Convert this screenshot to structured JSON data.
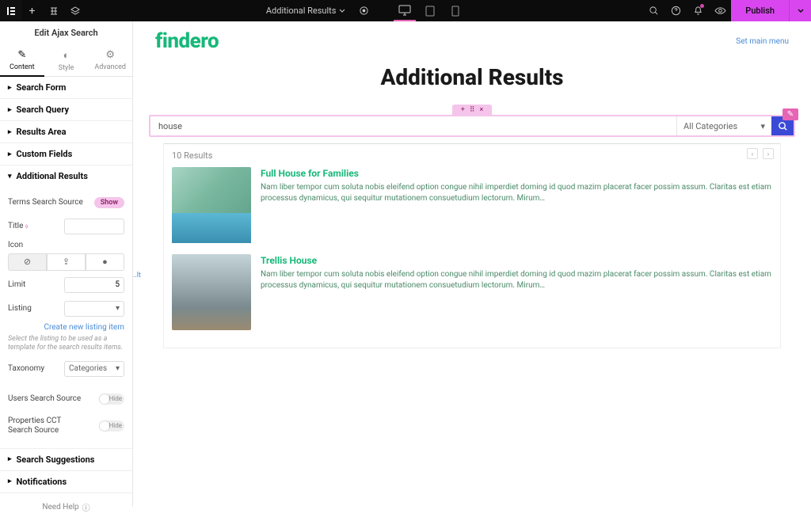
{
  "topbar": {
    "doc_label": "Additional Results",
    "publish": "Publish"
  },
  "sidebar": {
    "title": "Edit Ajax Search",
    "tabs": {
      "content": "Content",
      "style": "Style",
      "advanced": "Advanced"
    },
    "sections": {
      "search_form": "Search Form",
      "search_query": "Search Query",
      "results_area": "Results Area",
      "custom_fields": "Custom Fields",
      "additional_results": "Additional Results",
      "search_suggestions": "Search Suggestions",
      "notifications": "Notifications"
    },
    "ar": {
      "terms_source_label": "Terms Search Source",
      "terms_source_badge": "Show",
      "title_label": "Title",
      "icon_label": "Icon",
      "limit_label": "Limit",
      "limit_value": "5",
      "listing_label": "Listing",
      "create_link": "Create new listing item",
      "hint": "Select the listing to be used as a template for the search results items.",
      "taxonomy_label": "Taxonomy",
      "taxonomy_value": "Categories",
      "users_source_label": "Users Search Source",
      "users_source_toggle": "Hide",
      "props_source_label": "Properties CCT Search Source",
      "props_source_toggle": "Hide"
    },
    "help": "Need Help"
  },
  "preview": {
    "logo": "findero",
    "menu_link": "Set main menu",
    "page_title": "Additional Results",
    "search_value": "house",
    "cat_label": "All Categories",
    "results_count": "10 Results",
    "items": [
      {
        "title": "Full House for Families",
        "text": "Nam liber tempor cum soluta nobis eleifend option congue nihil imperdiet doming id quod mazim placerat facer possim assum. Claritas est etiam processus dynamicus, qui sequitur mutationem consuetudium lectorum. Mirum…"
      },
      {
        "title": "Trellis House",
        "text": "Nam liber tempor cum soluta nobis eleifend option congue nihil imperdiet doming id quod mazim placerat facer possim assum. Claritas est etiam processus dynamicus, qui sequitur mutationem consuetudium lectorum. Mirum…"
      }
    ]
  }
}
